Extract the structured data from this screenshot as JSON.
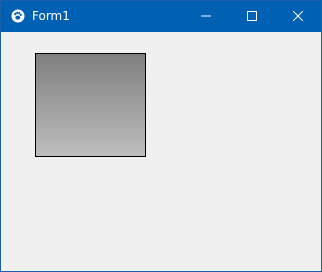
{
  "window": {
    "title": "Form1",
    "app_icon": "paw-icon",
    "controls": {
      "minimize_icon": "minimize-icon",
      "maximize_icon": "maximize-icon",
      "close_icon": "close-icon"
    }
  },
  "colors": {
    "titlebar": "#0061b4",
    "client_background": "#f0f0f0",
    "panel_gradient_top": "#7f7f7f",
    "panel_gradient_bottom": "#bdbdbd"
  }
}
